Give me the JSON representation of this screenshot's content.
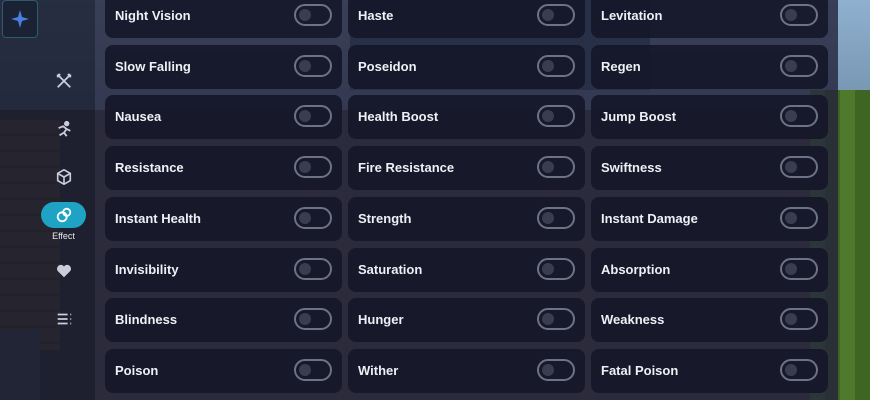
{
  "sidebar": {
    "logo": "sparkle-logo-icon",
    "items": [
      {
        "icon": "crossed-swords-icon",
        "label": ""
      },
      {
        "icon": "running-person-icon",
        "label": ""
      },
      {
        "icon": "cube-icon",
        "label": ""
      },
      {
        "icon": "potion-effect-icon",
        "label": "Effect",
        "active": true
      },
      {
        "icon": "heart-icon",
        "label": ""
      },
      {
        "icon": "list-icon",
        "label": ""
      }
    ]
  },
  "effects": [
    [
      {
        "label": "Night Vision",
        "on": false
      },
      {
        "label": "Haste",
        "on": false
      },
      {
        "label": "Levitation",
        "on": false
      }
    ],
    [
      {
        "label": "Slow Falling",
        "on": false
      },
      {
        "label": "Poseidon",
        "on": false
      },
      {
        "label": "Regen",
        "on": false
      }
    ],
    [
      {
        "label": "Nausea",
        "on": false
      },
      {
        "label": "Health Boost",
        "on": false
      },
      {
        "label": "Jump Boost",
        "on": false
      }
    ],
    [
      {
        "label": "Resistance",
        "on": false
      },
      {
        "label": "Fire Resistance",
        "on": false
      },
      {
        "label": "Swiftness",
        "on": false
      }
    ],
    [
      {
        "label": "Instant Health",
        "on": false
      },
      {
        "label": "Strength",
        "on": false
      },
      {
        "label": "Instant Damage",
        "on": false
      }
    ],
    [
      {
        "label": "Invisibility",
        "on": false
      },
      {
        "label": "Saturation",
        "on": false
      },
      {
        "label": "Absorption",
        "on": false
      }
    ],
    [
      {
        "label": "Blindness",
        "on": false
      },
      {
        "label": "Hunger",
        "on": false
      },
      {
        "label": "Weakness",
        "on": false
      }
    ],
    [
      {
        "label": "Poison",
        "on": false
      },
      {
        "label": "Wither",
        "on": false
      },
      {
        "label": "Fatal Poison",
        "on": false
      }
    ]
  ],
  "colors": {
    "accent": "#1fa3c4",
    "card_bg": "#16182a",
    "panel_bg": "#24263c"
  }
}
